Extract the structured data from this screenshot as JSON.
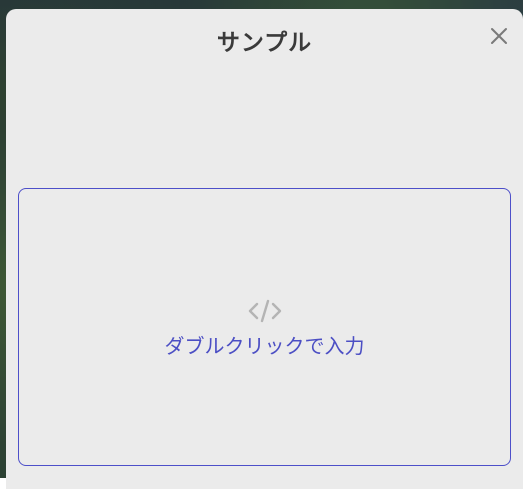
{
  "dialog": {
    "title": "サンプル",
    "close_icon": "close-icon"
  },
  "editor": {
    "icon": "code-icon",
    "hint": "ダブルクリックで入力"
  },
  "colors": {
    "accent": "#4c4fc4",
    "panel_bg": "#ebebeb",
    "title": "#3a3a3a",
    "icon_gray": "#b4b4b4"
  }
}
